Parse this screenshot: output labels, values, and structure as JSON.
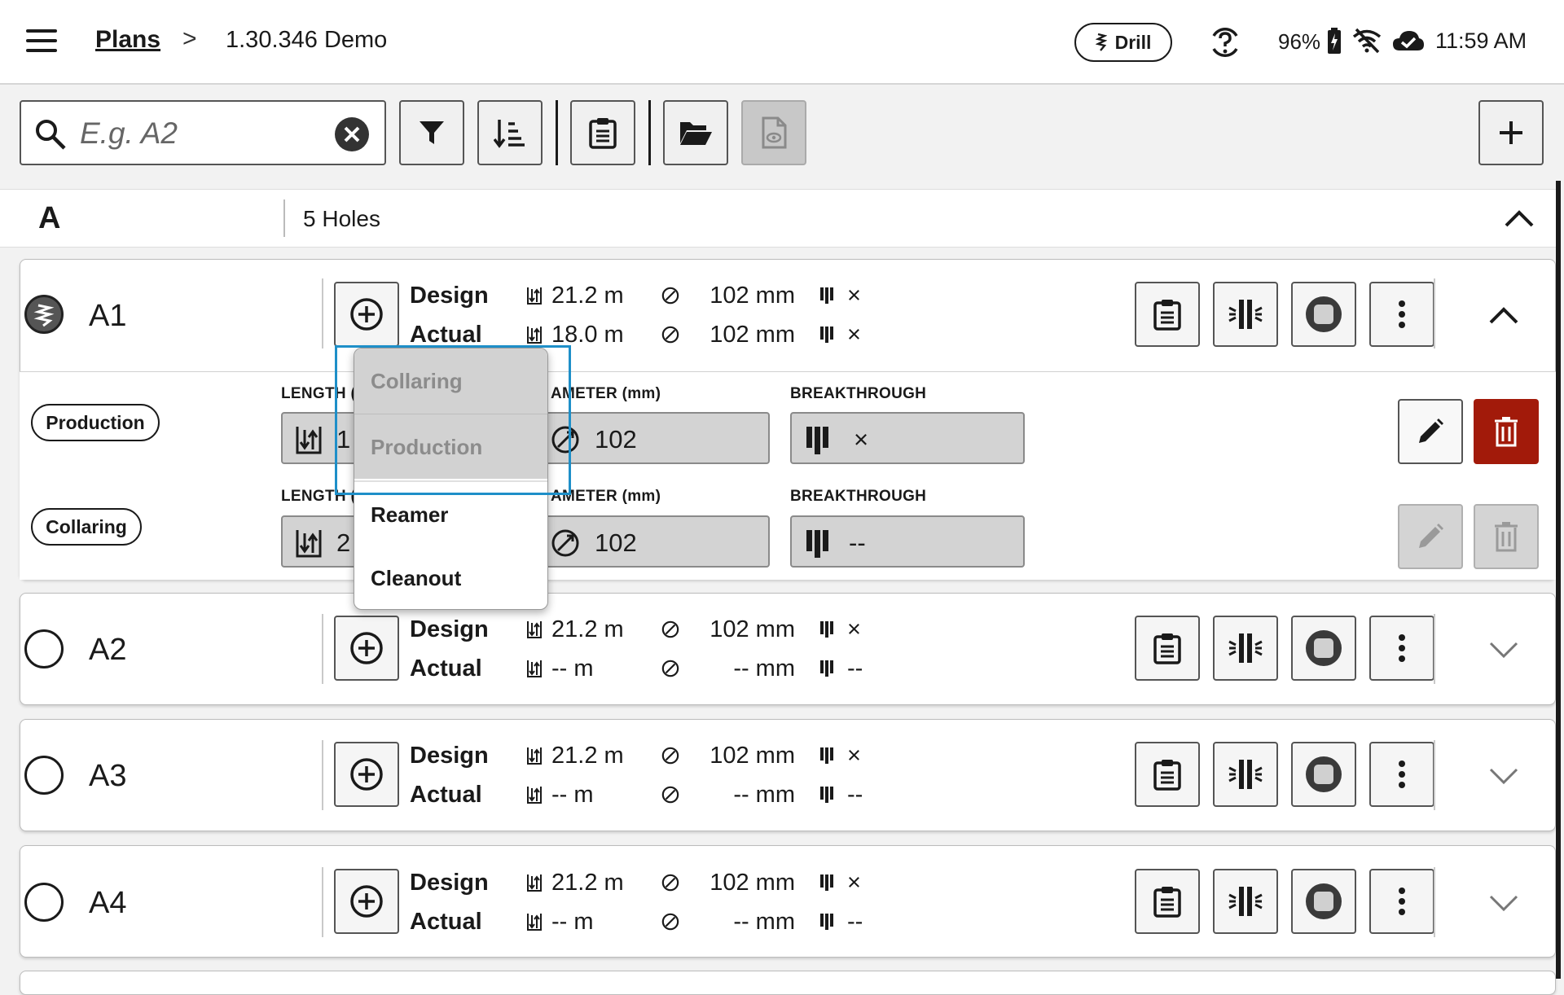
{
  "header": {
    "breadcrumb_root": "Plans",
    "breadcrumb_sep": ">",
    "breadcrumb_current": "1.30.346 Demo",
    "mode_chip": "Drill",
    "battery": "96%",
    "time": "11:59 AM"
  },
  "toolbar": {
    "search_placeholder": "E.g. A2",
    "icons": [
      "search-icon",
      "clear-icon",
      "filter-icon",
      "sort-icon",
      "clipboard-icon",
      "folder-open-icon",
      "preview-file-icon",
      "plus-icon"
    ]
  },
  "group": {
    "letter": "A",
    "count": "5 Holes"
  },
  "row_labels": {
    "design": "Design",
    "actual": "Actual"
  },
  "holes": [
    {
      "name": "A1",
      "design_len": "21.2 m",
      "design_dia": "102 mm",
      "design_bt": "×",
      "actual_len": "18.0 m",
      "actual_dia": "102 mm",
      "actual_bt": "×"
    },
    {
      "name": "A2",
      "design_len": "21.2 m",
      "design_dia": "102 mm",
      "design_bt": "×",
      "actual_len": "-- m",
      "actual_dia": "-- mm",
      "actual_bt": "--"
    },
    {
      "name": "A3",
      "design_len": "21.2 m",
      "design_dia": "102 mm",
      "design_bt": "×",
      "actual_len": "-- m",
      "actual_dia": "-- mm",
      "actual_bt": "--"
    },
    {
      "name": "A4",
      "design_len": "21.2 m",
      "design_dia": "102 mm",
      "design_bt": "×",
      "actual_len": "-- m",
      "actual_dia": "-- mm",
      "actual_bt": "--"
    }
  ],
  "expanded": {
    "pass_rows": [
      {
        "type": "Production",
        "length_label": "LENGTH (m",
        "length_value": "1",
        "diameter_label": "AMETER (mm)",
        "diameter_value": "102",
        "breakthrough_label": "BREAKTHROUGH",
        "breakthrough_value": "×"
      },
      {
        "type": "Collaring",
        "length_label": "LENGTH (",
        "length_value": "2",
        "diameter_label": "AMETER (mm)",
        "diameter_value": "102",
        "breakthrough_label": "BREAKTHROUGH",
        "breakthrough_value": "--"
      }
    ]
  },
  "dropdown": {
    "options": [
      {
        "label": "Collaring",
        "enabled": false
      },
      {
        "label": "Production",
        "enabled": false
      },
      {
        "label": "Reamer",
        "enabled": true
      },
      {
        "label": "Cleanout",
        "enabled": true
      }
    ]
  },
  "colors": {
    "delete_active": "#a21a0a",
    "highlight": "#1e8fc8",
    "field_bg": "#d3d3d3"
  }
}
